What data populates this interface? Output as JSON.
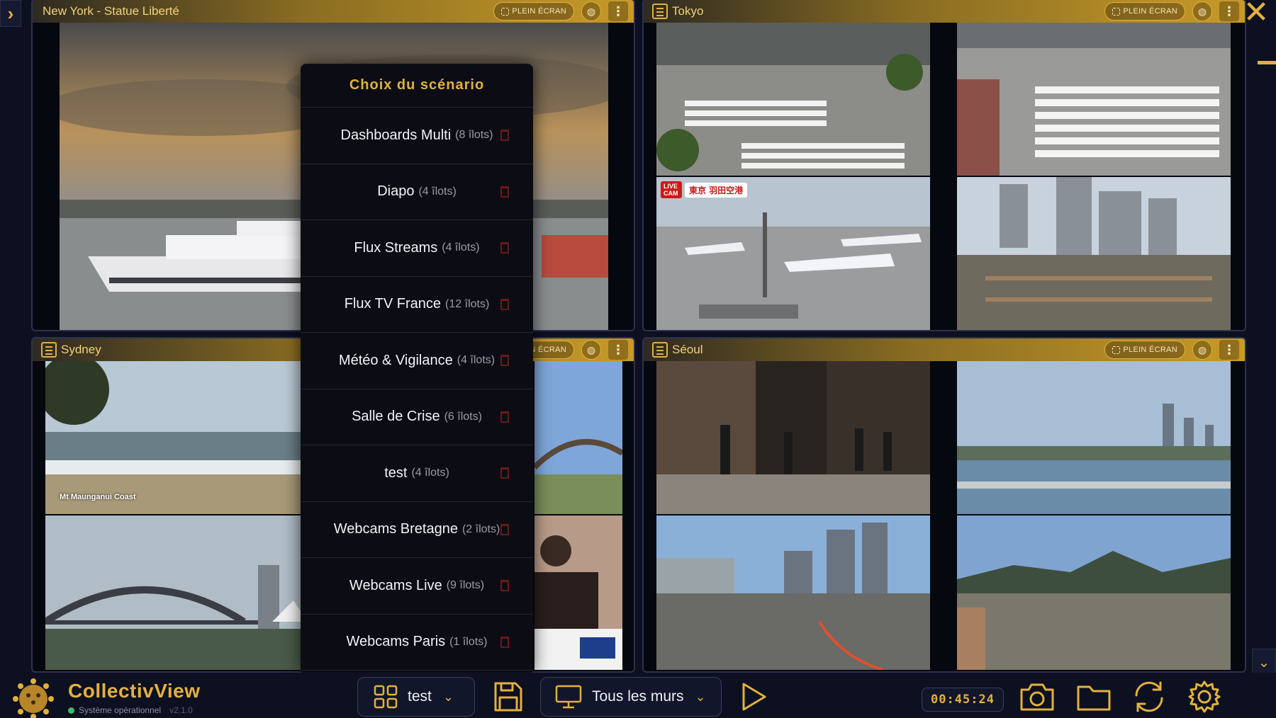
{
  "app": {
    "brand": "CollectivView",
    "status": "Système opérationnel",
    "version": "v2.1.0"
  },
  "panels": [
    {
      "title": "New York - Statue Liberté",
      "fullscreen_label": "PLEIN ÉCRAN"
    },
    {
      "title": "Tokyo",
      "fullscreen_label": "PLEIN ÉCRAN"
    },
    {
      "title": "Sydney",
      "fullscreen_label": "PLEIN ÉCRAN"
    },
    {
      "title": "Séoul",
      "fullscreen_label": "PLEIN ÉCRAN"
    }
  ],
  "feed_labels": {
    "sydney_coast": "Mt Maunganui Coast",
    "tokyo_live": "LIVE CAM",
    "tokyo_airport": "東京 羽田空港"
  },
  "scenario_menu": {
    "title": "Choix du scénario",
    "items": [
      {
        "name": "Dashboards Multi",
        "count": "(8 îlots)"
      },
      {
        "name": "Diapo",
        "count": "(4 îlots)"
      },
      {
        "name": "Flux Streams",
        "count": "(4 îlots)"
      },
      {
        "name": "Flux TV France",
        "count": "(12 îlots)"
      },
      {
        "name": "Météo & Vigilance",
        "count": "(4 îlots)"
      },
      {
        "name": "Salle de Crise",
        "count": "(6 îlots)"
      },
      {
        "name": "test",
        "count": "(4 îlots)"
      },
      {
        "name": "Webcams Bretagne",
        "count": "(2 îlots)"
      },
      {
        "name": "Webcams Live",
        "count": "(9 îlots)"
      },
      {
        "name": "Webcams Paris",
        "count": "(1 îlots)"
      }
    ]
  },
  "toolbar": {
    "scenario_select": "test",
    "wall_select": "Tous les murs",
    "timer": "00:45:24"
  },
  "colors": {
    "accent": "#e2b13c",
    "background": "#0c1020",
    "status_ok": "#36c060"
  }
}
